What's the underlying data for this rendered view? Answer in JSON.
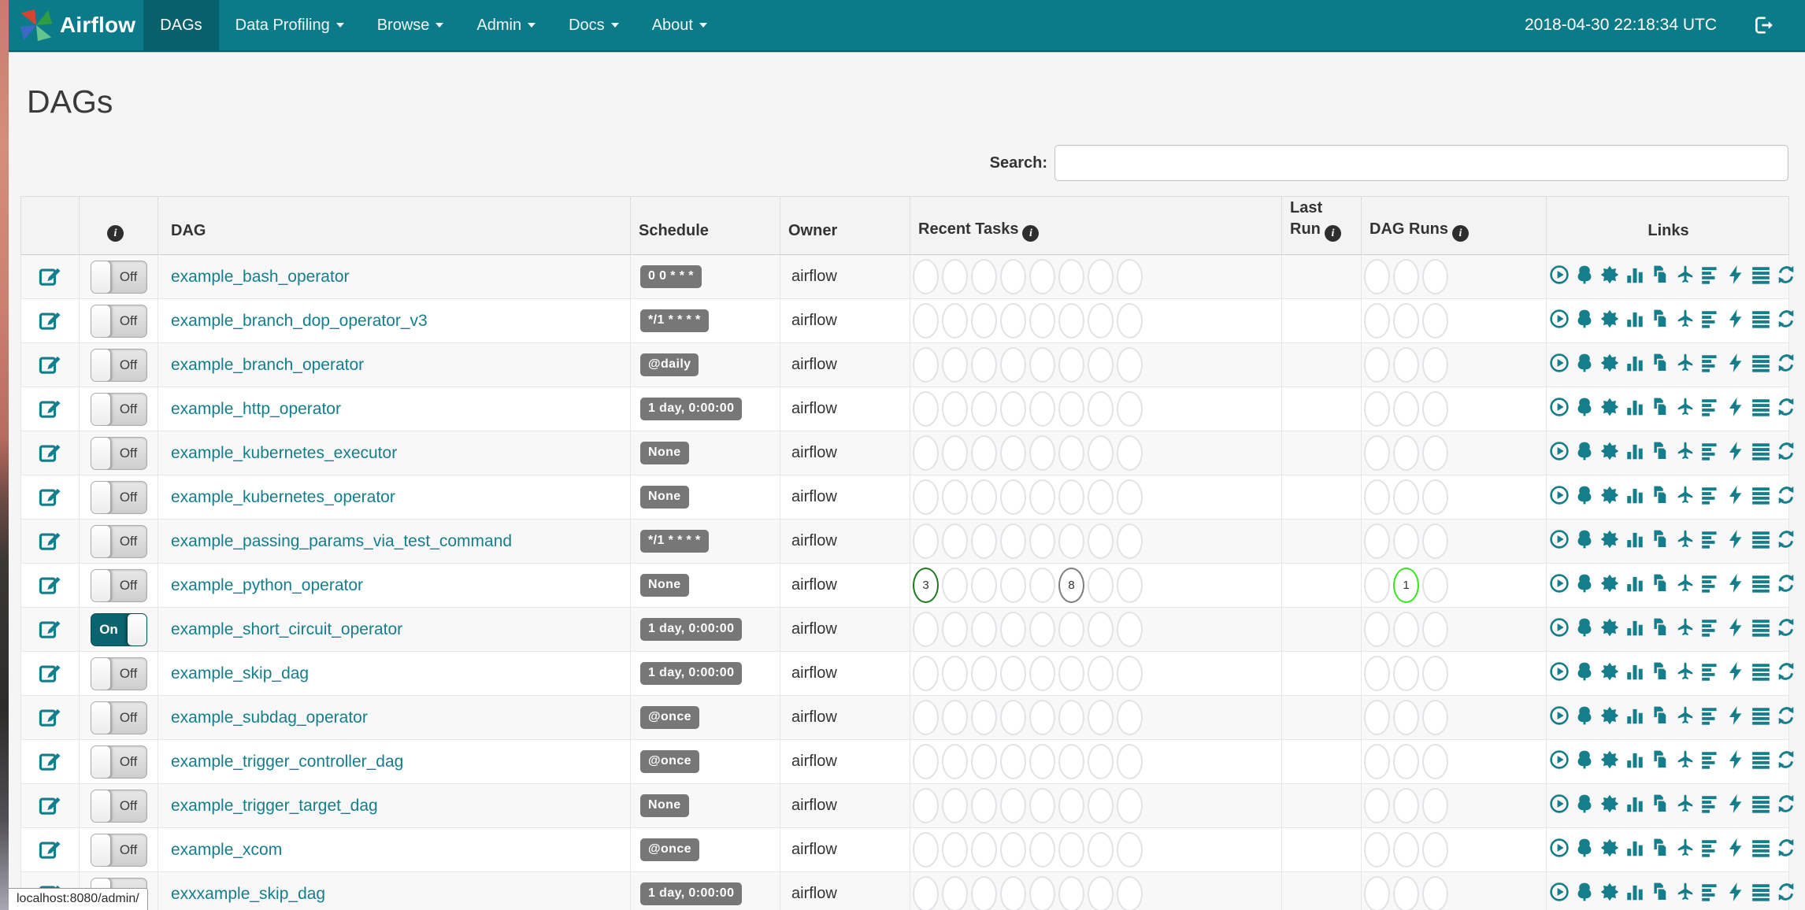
{
  "colors": {
    "navbar": "#0c7b89",
    "navbar_active": "#07616d",
    "link": "#147e8d",
    "badge_bg": "#777777",
    "toggle_on_bg": "#0c6370",
    "success": "#1e7a1e",
    "running": "#35e61c",
    "queued": "#7d7d7d",
    "empty_ring": "#e2e2e7"
  },
  "navbar": {
    "brand": "Airflow",
    "logo_icon": "airflow-pinwheel-logo",
    "items": [
      {
        "label": "DAGs",
        "active": true,
        "caret": false
      },
      {
        "label": "Data Profiling",
        "active": false,
        "caret": true
      },
      {
        "label": "Browse",
        "active": false,
        "caret": true
      },
      {
        "label": "Admin",
        "active": false,
        "caret": true
      },
      {
        "label": "Docs",
        "active": false,
        "caret": true
      },
      {
        "label": "About",
        "active": false,
        "caret": true
      }
    ],
    "clock": "2018-04-30 22:18:34 UTC",
    "logout_icon": "logout-icon"
  },
  "page": {
    "title": "DAGs",
    "search_label": "Search:",
    "search_value": "",
    "status_bar": "localhost:8080/admin/"
  },
  "table": {
    "headers": {
      "info_icon": "info-icon",
      "dag": "DAG",
      "schedule": "Schedule",
      "owner": "Owner",
      "recent_tasks": "Recent Tasks",
      "last_run": "Last Run",
      "dag_runs": "DAG Runs",
      "links": "Links"
    },
    "toggle": {
      "on": "On",
      "off": "Off"
    },
    "recent_task_slots": 8,
    "dag_run_slots": 3,
    "link_icons": [
      "trigger-dag-icon",
      "tree-view-icon",
      "graph-view-icon",
      "task-duration-icon",
      "task-tries-icon",
      "landing-times-icon",
      "gantt-icon",
      "code-icon",
      "details-icon",
      "refresh-icon"
    ],
    "rows": [
      {
        "name": "example_bash_operator",
        "enabled": false,
        "schedule": "0 0 * * *",
        "owner": "airflow",
        "last_run": "",
        "recent_tasks": [],
        "dag_runs": []
      },
      {
        "name": "example_branch_dop_operator_v3",
        "enabled": false,
        "schedule": "*/1 * * * *",
        "owner": "airflow",
        "last_run": "",
        "recent_tasks": [],
        "dag_runs": []
      },
      {
        "name": "example_branch_operator",
        "enabled": false,
        "schedule": "@daily",
        "owner": "airflow",
        "last_run": "",
        "recent_tasks": [],
        "dag_runs": []
      },
      {
        "name": "example_http_operator",
        "enabled": false,
        "schedule": "1 day, 0:00:00",
        "owner": "airflow",
        "last_run": "",
        "recent_tasks": [],
        "dag_runs": []
      },
      {
        "name": "example_kubernetes_executor",
        "enabled": false,
        "schedule": "None",
        "owner": "airflow",
        "last_run": "",
        "recent_tasks": [],
        "dag_runs": []
      },
      {
        "name": "example_kubernetes_operator",
        "enabled": false,
        "schedule": "None",
        "owner": "airflow",
        "last_run": "",
        "recent_tasks": [],
        "dag_runs": []
      },
      {
        "name": "example_passing_params_via_test_command",
        "enabled": false,
        "schedule": "*/1 * * * *",
        "owner": "airflow",
        "last_run": "",
        "recent_tasks": [],
        "dag_runs": []
      },
      {
        "name": "example_python_operator",
        "enabled": false,
        "schedule": "None",
        "owner": "airflow",
        "last_run": "",
        "recent_tasks": [
          {
            "slot": 0,
            "count": 3,
            "status": "success"
          },
          {
            "slot": 5,
            "count": 8,
            "status": "queued"
          }
        ],
        "dag_runs": [
          {
            "slot": 1,
            "count": 1,
            "status": "running"
          }
        ]
      },
      {
        "name": "example_short_circuit_operator",
        "enabled": true,
        "schedule": "1 day, 0:00:00",
        "owner": "airflow",
        "last_run": "",
        "recent_tasks": [],
        "dag_runs": []
      },
      {
        "name": "example_skip_dag",
        "enabled": false,
        "schedule": "1 day, 0:00:00",
        "owner": "airflow",
        "last_run": "",
        "recent_tasks": [],
        "dag_runs": []
      },
      {
        "name": "example_subdag_operator",
        "enabled": false,
        "schedule": "@once",
        "owner": "airflow",
        "last_run": "",
        "recent_tasks": [],
        "dag_runs": []
      },
      {
        "name": "example_trigger_controller_dag",
        "enabled": false,
        "schedule": "@once",
        "owner": "airflow",
        "last_run": "",
        "recent_tasks": [],
        "dag_runs": []
      },
      {
        "name": "example_trigger_target_dag",
        "enabled": false,
        "schedule": "None",
        "owner": "airflow",
        "last_run": "",
        "recent_tasks": [],
        "dag_runs": []
      },
      {
        "name": "example_xcom",
        "enabled": false,
        "schedule": "@once",
        "owner": "airflow",
        "last_run": "",
        "recent_tasks": [],
        "dag_runs": []
      },
      {
        "name": "exxxample_skip_dag",
        "enabled": false,
        "schedule": "1 day, 0:00:00",
        "owner": "airflow",
        "last_run": "",
        "recent_tasks": [],
        "dag_runs": []
      }
    ]
  }
}
